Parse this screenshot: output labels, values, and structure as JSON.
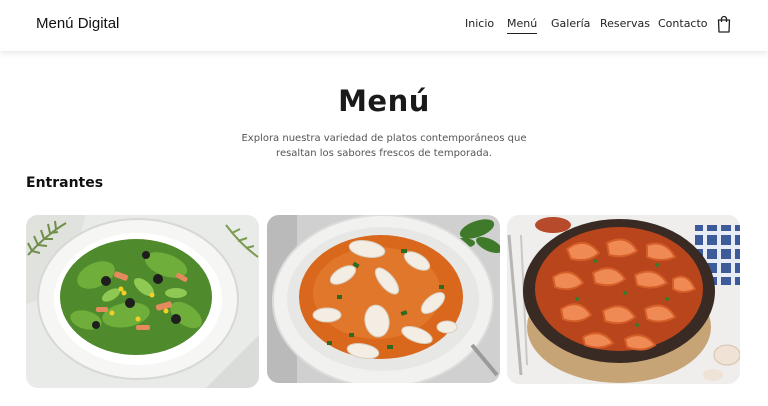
{
  "header": {
    "brand": "Menú Digital",
    "nav": [
      {
        "label": "Inicio"
      },
      {
        "label": "Menú"
      },
      {
        "label": "Galería"
      },
      {
        "label": "Reservas"
      },
      {
        "label": "Contacto"
      }
    ],
    "active_nav": "Menú",
    "cart_icon": "shopping-bag-icon"
  },
  "main": {
    "title": "Menú",
    "subtitle": "Explora nuestra variedad de platos contemporáneos que resaltan los sabores frescos de temporada.",
    "section_title": "Entrantes",
    "cards": [
      {
        "image": "green-salad-photo"
      },
      {
        "image": "seafood-soup-photo"
      },
      {
        "image": "garlic-shrimp-photo"
      }
    ]
  },
  "colors": {
    "background": "#ffffff",
    "text": "#111111",
    "muted_text": "#555555"
  }
}
